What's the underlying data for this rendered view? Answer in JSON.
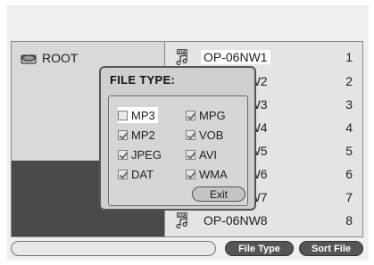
{
  "root": {
    "label": "ROOT"
  },
  "files": [
    {
      "name": "OP-06NW1",
      "num": "1",
      "selected": true
    },
    {
      "name": "OP-06NW2",
      "num": "2",
      "selected": false
    },
    {
      "name": "OP-06NW3",
      "num": "3",
      "selected": false
    },
    {
      "name": "OP-06NW4",
      "num": "4",
      "selected": false
    },
    {
      "name": "OP-06NW5",
      "num": "5",
      "selected": false
    },
    {
      "name": "OP-06NW6",
      "num": "6",
      "selected": false
    },
    {
      "name": "OP-06NW7",
      "num": "7",
      "selected": false
    },
    {
      "name": "OP-06NW8",
      "num": "8",
      "selected": false
    }
  ],
  "dialog": {
    "title": "FILE TYPE:",
    "options": [
      {
        "label": "MP3",
        "checked": false
      },
      {
        "label": "MPG",
        "checked": true
      },
      {
        "label": "MP2",
        "checked": true
      },
      {
        "label": "VOB",
        "checked": true
      },
      {
        "label": "JPEG",
        "checked": true
      },
      {
        "label": "AVI",
        "checked": true
      },
      {
        "label": "DAT",
        "checked": true
      },
      {
        "label": "WMA",
        "checked": true
      }
    ],
    "exit_label": "Exit"
  },
  "bottom": {
    "path_value": "",
    "file_type_label": "File Type",
    "sort_file_label": "Sort File"
  },
  "icons": {
    "drive": "disc-drive-icon",
    "file": "mp3-file-icon"
  },
  "colors": {
    "background": "#efefef",
    "dark_panel": "#4a4a4a",
    "button": "#555555"
  }
}
